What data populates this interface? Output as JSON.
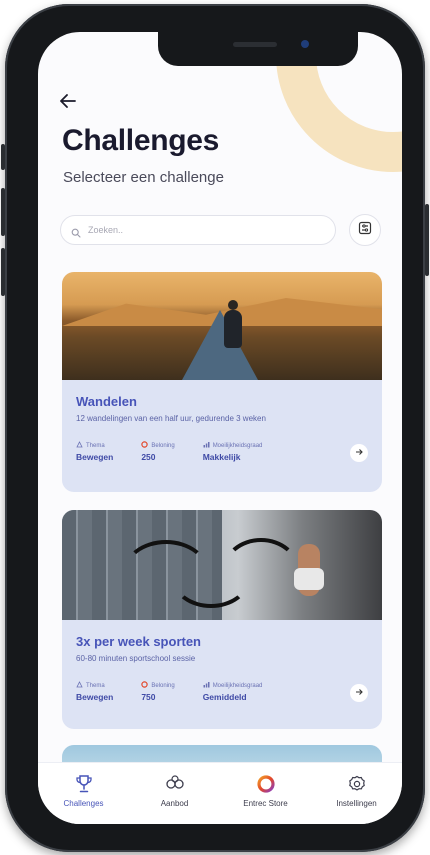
{
  "header": {
    "back_icon": "arrow-left-icon",
    "title": "Challenges",
    "subtitle": "Selecteer een challenge"
  },
  "search": {
    "placeholder": "Zoeken..",
    "value": "",
    "icon": "search-icon",
    "filter_icon": "filter-icon"
  },
  "colors": {
    "accent": "#4754b8",
    "card_bg": "#dde3f4",
    "deco": "#f6e3bf",
    "logo_ring": "#e2472a"
  },
  "cards": [
    {
      "title": "Wandelen",
      "description": "12 wandelingen van een half uur, gedurende 3 weken",
      "theme_label": "Thema",
      "theme_value": "Bewegen",
      "reward_label": "Beloning",
      "reward_value": "250",
      "difficulty_label": "Moeilijkheidsgraad",
      "difficulty_value": "Makkelijk"
    },
    {
      "title": "3x per week sporten",
      "description": "60-80 minuten sportschool sessie",
      "theme_label": "Thema",
      "theme_value": "Bewegen",
      "reward_label": "Beloning",
      "reward_value": "750",
      "difficulty_label": "Moeilijkheidsgraad",
      "difficulty_value": "Gemiddeld"
    }
  ],
  "nav": [
    {
      "label": "Challenges",
      "icon": "trophy-icon",
      "active": true
    },
    {
      "label": "Aanbod",
      "icon": "gift-icon",
      "active": false
    },
    {
      "label": "Entrec Store",
      "icon": "store-ring-icon",
      "active": false
    },
    {
      "label": "Instellingen",
      "icon": "gear-icon",
      "active": false
    }
  ]
}
